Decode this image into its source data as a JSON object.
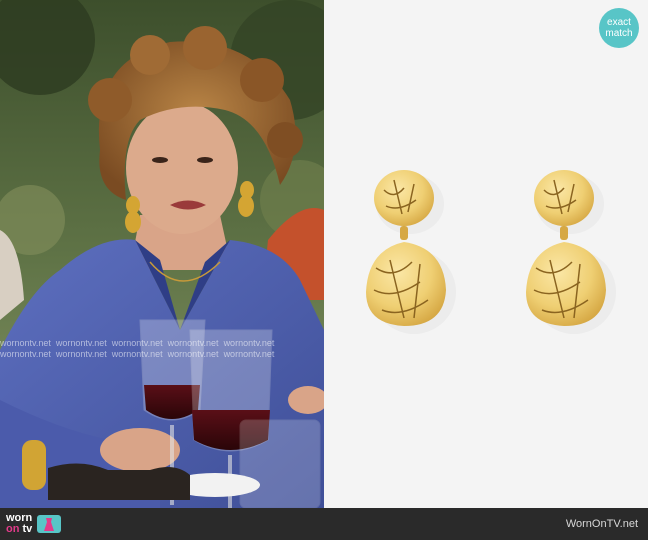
{
  "badge": {
    "line1": "exact",
    "line2": "match"
  },
  "footer": {
    "site": "WornOnTV.net"
  },
  "logo": {
    "worn": "worn",
    "on": "on",
    "tv": "tv"
  },
  "watermark": {
    "text": "wornontv.net"
  }
}
